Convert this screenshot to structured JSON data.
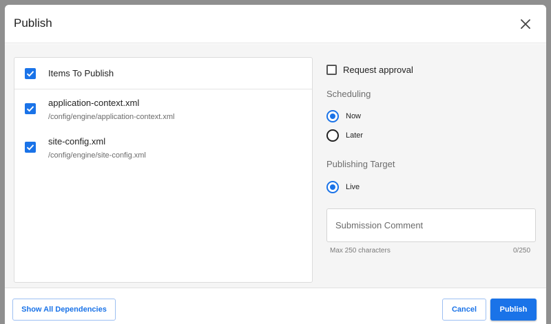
{
  "dialog": {
    "title": "Publish",
    "close_icon": "close-icon"
  },
  "items": {
    "header_label": "Items To Publish",
    "header_checked": true,
    "list": [
      {
        "name": "application-context.xml",
        "path": "/config/engine/application-context.xml",
        "checked": true
      },
      {
        "name": "site-config.xml",
        "path": "/config/engine/site-config.xml",
        "checked": true
      }
    ]
  },
  "options": {
    "request_approval_label": "Request approval",
    "request_approval_checked": false,
    "scheduling_label": "Scheduling",
    "scheduling_options": [
      {
        "label": "Now",
        "selected": true
      },
      {
        "label": "Later",
        "selected": false
      }
    ],
    "target_label": "Publishing Target",
    "target_options": [
      {
        "label": "Live",
        "selected": true
      }
    ],
    "comment_placeholder": "Submission Comment",
    "comment_value": "",
    "comment_helper": "Max 250 characters",
    "comment_count": "0/250"
  },
  "footer": {
    "dependencies_label": "Show All Dependencies",
    "cancel_label": "Cancel",
    "publish_label": "Publish"
  },
  "colors": {
    "accent": "#1a73e8",
    "body_bg": "#f5f5f5"
  }
}
